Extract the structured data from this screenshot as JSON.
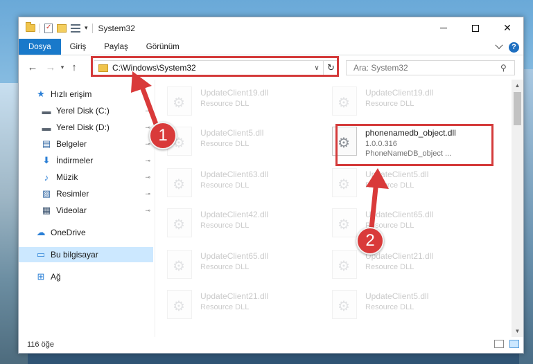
{
  "title_bar": {
    "title": "System32",
    "qat_dropdown": "▾",
    "separator": "|",
    "minimize_label": "",
    "maximize_label": "",
    "close_label": "✕"
  },
  "ribbon": {
    "tabs": [
      "Dosya",
      "Giriş",
      "Paylaş",
      "Görünüm"
    ],
    "help": "?"
  },
  "navigation": {
    "back": "←",
    "forward": "→",
    "recent": "▾",
    "up": "↑",
    "address_path": "C:\\Windows\\System32",
    "address_dropdown": "∨",
    "refresh": "↻",
    "search_placeholder": "Ara: System32",
    "search_icon": "⚲"
  },
  "sidebar": {
    "items": [
      {
        "label": "Hızlı erişim",
        "icon": "star-icon",
        "glyph": "★",
        "color": "#2a7fd6",
        "pinned": false
      },
      {
        "label": "Yerel Disk (C:)",
        "icon": "drive-icon",
        "glyph": "▬",
        "color": "#5a6470",
        "pinned": true
      },
      {
        "label": "Yerel Disk (D:)",
        "icon": "drive-icon",
        "glyph": "▬",
        "color": "#5a6470",
        "pinned": true
      },
      {
        "label": "Belgeler",
        "icon": "documents-icon",
        "glyph": "▤",
        "color": "#3c6fa8",
        "pinned": true
      },
      {
        "label": "İndirmeler",
        "icon": "download-icon",
        "glyph": "⬇",
        "color": "#2a7fd6",
        "pinned": true
      },
      {
        "label": "Müzik",
        "icon": "music-icon",
        "glyph": "♪",
        "color": "#2a7fd6",
        "pinned": true
      },
      {
        "label": "Resimler",
        "icon": "pictures-icon",
        "glyph": "▨",
        "color": "#3c6fa8",
        "pinned": true
      },
      {
        "label": "Videolar",
        "icon": "videos-icon",
        "glyph": "▦",
        "color": "#3c5470",
        "pinned": true
      },
      {
        "label": "OneDrive",
        "icon": "cloud-icon",
        "glyph": "☁",
        "color": "#2a7fd6",
        "pinned": false
      },
      {
        "label": "Bu bilgisayar",
        "icon": "computer-icon",
        "glyph": "▭",
        "color": "#2a7fd6",
        "pinned": false
      },
      {
        "label": "Ağ",
        "icon": "network-icon",
        "glyph": "⊞",
        "color": "#2a7fd6",
        "pinned": false
      }
    ],
    "pin_glyph": "📌"
  },
  "files": [
    {
      "name": "UpdateClient19.dll",
      "desc": "Resource DLL",
      "faded": true
    },
    {
      "name": "UpdateClient19.dll",
      "desc": "Resource DLL",
      "faded": true
    },
    {
      "name": "UpdateClient5.dll",
      "desc": "Resource DLL",
      "faded": true
    },
    {
      "name": "phonenamedb_object.dll",
      "desc": "1.0.0.316",
      "desc2": "PhoneNameDB_object ...",
      "faded": false
    },
    {
      "name": "UpdateClient63.dll",
      "desc": "Resource DLL",
      "faded": true
    },
    {
      "name": "UpdateClient5.dll",
      "desc": "Resource DLL",
      "faded": true
    },
    {
      "name": "UpdateClient42.dll",
      "desc": "Resource DLL",
      "faded": true
    },
    {
      "name": "UpdateClient65.dll",
      "desc": "Resource DLL",
      "faded": true
    },
    {
      "name": "UpdateClient65.dll",
      "desc": "Resource DLL",
      "faded": true
    },
    {
      "name": "UpdateClient21.dll",
      "desc": "Resource DLL",
      "faded": true
    },
    {
      "name": "UpdateClient21.dll",
      "desc": "Resource DLL",
      "faded": true
    },
    {
      "name": "UpdateClient5.dll",
      "desc": "Resource DLL",
      "faded": true
    }
  ],
  "status": {
    "count": "116 öğe"
  },
  "annotations": {
    "step1": "1",
    "step2": "2",
    "color": "#d93a3a"
  }
}
